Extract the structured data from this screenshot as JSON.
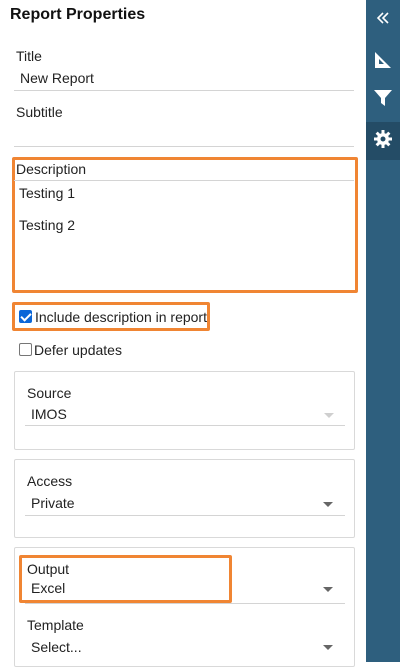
{
  "panel": {
    "title": "Report Properties",
    "title_field": {
      "label": "Title",
      "value": "New Report"
    },
    "subtitle_field": {
      "label": "Subtitle",
      "value": ""
    },
    "description_field": {
      "label": "Description",
      "lines": [
        "Testing 1",
        "Testing 2"
      ]
    },
    "include_description": {
      "label": "Include description in report",
      "checked": true
    },
    "defer_updates": {
      "label": "Defer updates",
      "checked": false
    },
    "source": {
      "label": "Source",
      "value": "IMOS"
    },
    "access": {
      "label": "Access",
      "value": "Private"
    },
    "output": {
      "label": "Output",
      "value": "Excel"
    },
    "template": {
      "label": "Template",
      "value": "Select..."
    }
  },
  "sidebar": {
    "buttons": [
      {
        "icon": "double-chevron-left-icon"
      },
      {
        "icon": "ruler-triangle-icon"
      },
      {
        "icon": "filter-icon"
      },
      {
        "icon": "gear-icon",
        "active": true
      }
    ]
  },
  "colors": {
    "highlight": "#f08533",
    "sidebar": "#2e5f7e",
    "sidebar_active": "#244c66",
    "checkbox": "#0a66d8"
  }
}
